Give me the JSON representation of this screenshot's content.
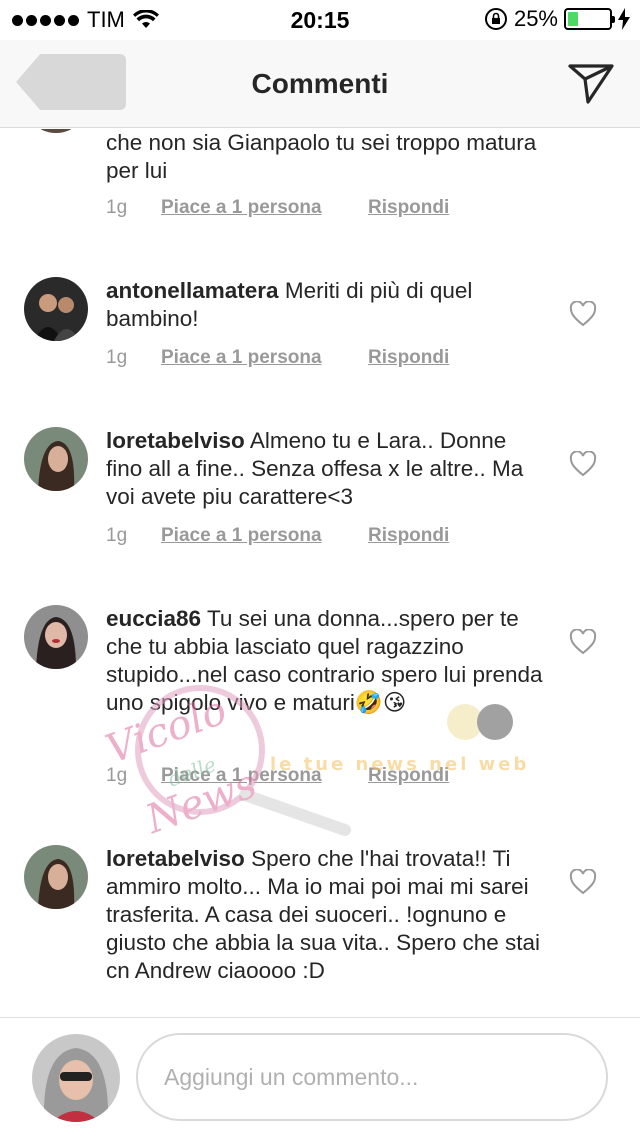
{
  "status_bar": {
    "carrier": "TIM",
    "time": "20:15",
    "battery_percent": "25%",
    "battery_level": 0.25,
    "battery_color": "#4cd964"
  },
  "nav": {
    "title": "Commenti"
  },
  "comments": [
    {
      "username": "",
      "text": "che non sia Gianpaolo tu sei troppo matura per lui",
      "age": "1g",
      "likes": "Piace a 1 persona",
      "reply": "Rispondi"
    },
    {
      "username": "antonellamatera",
      "text": "Meriti di più di quel bambino!",
      "age": "1g",
      "likes": "Piace a 1 persona",
      "reply": "Rispondi"
    },
    {
      "username": "loretabelviso",
      "text": "Almeno tu e Lara.. Donne fino all a fine.. Senza offesa x le altre.. Ma voi avete piu carattere<3",
      "age": "1g",
      "likes": "Piace a 1 persona",
      "reply": "Rispondi"
    },
    {
      "username": "euccia86",
      "text": "Tu sei una donna...spero per te che tu abbia lasciato quel ragazzino stupido...nel caso contrario spero lui prenda uno spigolo vivo e maturi🤣😘",
      "age": "1g",
      "likes": "Piace a 1 persona",
      "reply": "Rispondi"
    },
    {
      "username": "loretabelviso",
      "text": "Spero che l'hai trovata!! Ti ammiro molto... Ma io mai poi mai mi sarei trasferita. A casa dei suoceri.. !ognuno e giusto che abbia la sua vita.. Spero che stai cn Andrew ciaoooo :D"
    }
  ],
  "watermark": {
    "line1": "Vicolo",
    "line2": "delle",
    "line3": "News",
    "tagline": "le tue news nel web"
  },
  "composer": {
    "placeholder": "Aggiungi un commento..."
  }
}
